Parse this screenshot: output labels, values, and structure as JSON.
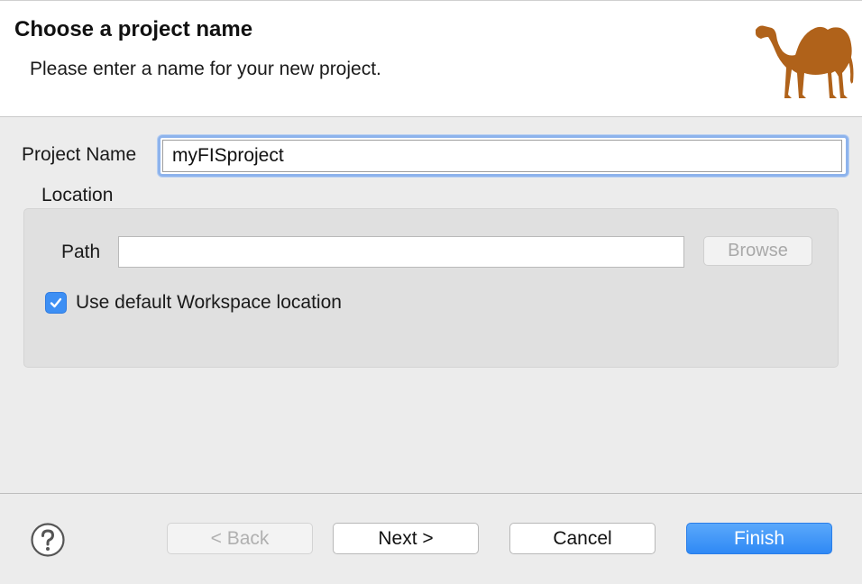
{
  "header": {
    "title": "Choose a project name",
    "description": "Please enter a name for your new project.",
    "logo_icon": "camel-icon",
    "logo_color": "#b0621a"
  },
  "form": {
    "project_name_label": "Project Name",
    "project_name_value": "myFISproject",
    "location_label": "Location",
    "path_label": "Path",
    "path_value": "",
    "browse_label": "Browse",
    "use_default_label": "Use default Workspace location",
    "use_default_checked": true
  },
  "footer": {
    "help_icon": "help-icon",
    "back_label": "< Back",
    "next_label": "Next >",
    "cancel_label": "Cancel",
    "finish_label": "Finish"
  },
  "colors": {
    "accent": "#3d8ff4",
    "focus_ring": "#8db3ec"
  }
}
